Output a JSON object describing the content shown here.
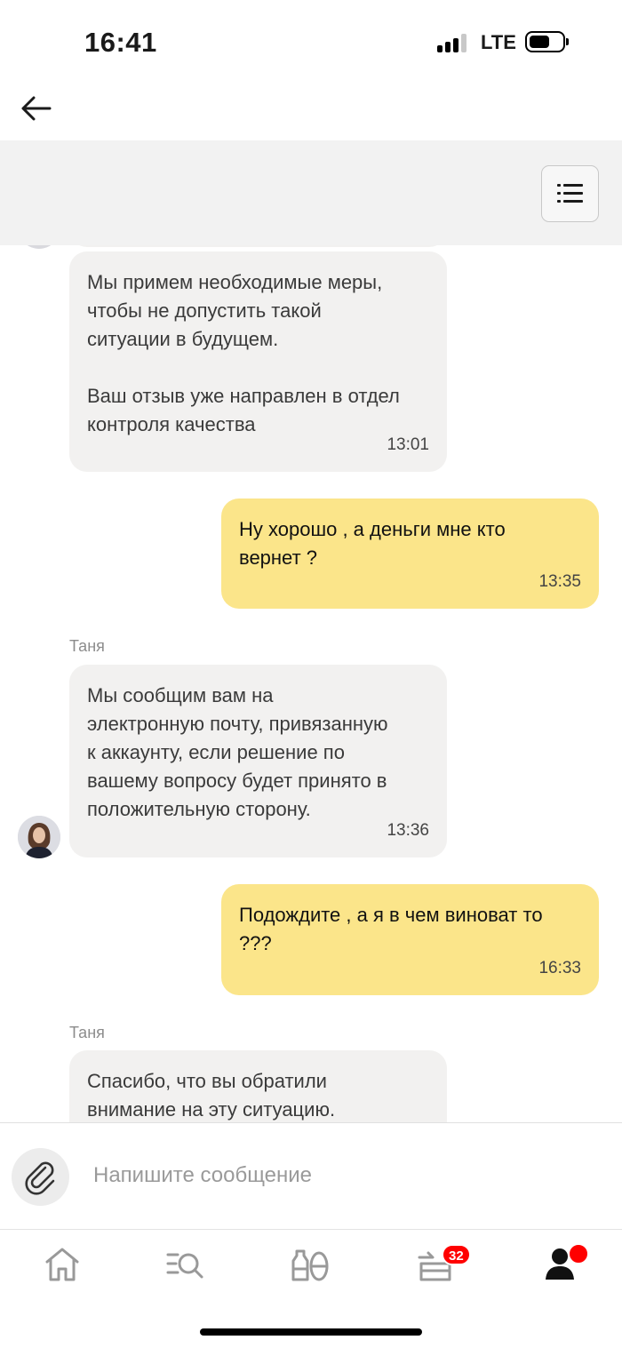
{
  "status_bar": {
    "time": "16:41",
    "network": "LTE"
  },
  "chat": {
    "messages": [
      {
        "side": "in",
        "sender": "",
        "text": "Мы примем необходимые меры,\nчтобы не допустить такой\nситуации в будущем.\n\nВаш отзыв уже направлен в отдел\nконтроля качества",
        "time": "13:01"
      },
      {
        "side": "out",
        "text": "Ну хорошо , а деньги мне кто\nвернет ?",
        "time": "13:35"
      },
      {
        "side": "in",
        "sender": "Таня",
        "text": "Мы сообщим вам на\nэлектронную почту, привязанную\nк аккаунту, если решение по\nвашему вопросу будет принято в\nположительную сторону.",
        "time": "13:36"
      },
      {
        "side": "out",
        "text": "Подождите , а я в чем виноват то\n???",
        "time": "16:33"
      },
      {
        "side": "in",
        "sender": "Таня",
        "text": "Спасибо, что вы обратили\nвнимание на эту ситуацию.",
        "time": ""
      }
    ]
  },
  "composer": {
    "placeholder": "Напишите сообщение"
  },
  "bottom_nav": {
    "items": [
      {
        "icon": "home-icon"
      },
      {
        "icon": "catalog-search-icon"
      },
      {
        "icon": "products-icon"
      },
      {
        "icon": "cart-icon"
      },
      {
        "icon": "profile-icon"
      }
    ],
    "cart_badge": "32"
  },
  "colors": {
    "incoming_bubble": "#f2f1f0",
    "outgoing_bubble": "#fbe58a",
    "badge": "#ff0000",
    "topbar": "#f2f2f2"
  }
}
